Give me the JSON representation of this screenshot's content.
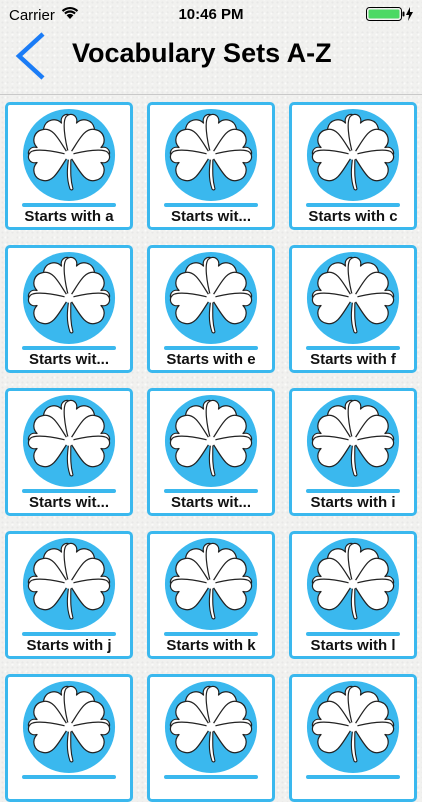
{
  "status_bar": {
    "carrier": "Carrier",
    "time": "10:46 PM",
    "wifi_icon": "wifi-icon",
    "battery_icon": "battery-charging-icon",
    "battery_level": 1.0,
    "battery_color": "#4cd964"
  },
  "header": {
    "title": "Vocabulary Sets A-Z",
    "back_icon": "chevron-left-icon",
    "accent_color": "#1b7cf6"
  },
  "tiles": [
    {
      "label": "Starts with a"
    },
    {
      "label": "Starts wit..."
    },
    {
      "label": "Starts with c"
    },
    {
      "label": "Starts wit..."
    },
    {
      "label": "Starts with e"
    },
    {
      "label": "Starts with f"
    },
    {
      "label": "Starts wit..."
    },
    {
      "label": "Starts wit..."
    },
    {
      "label": "Starts with i"
    },
    {
      "label": "Starts with j"
    },
    {
      "label": "Starts with k"
    },
    {
      "label": "Starts with l"
    },
    {
      "label": ""
    },
    {
      "label": ""
    },
    {
      "label": ""
    }
  ],
  "tile_icon": "four-leaf-clover-icon",
  "tile_color": "#3ab8ee"
}
